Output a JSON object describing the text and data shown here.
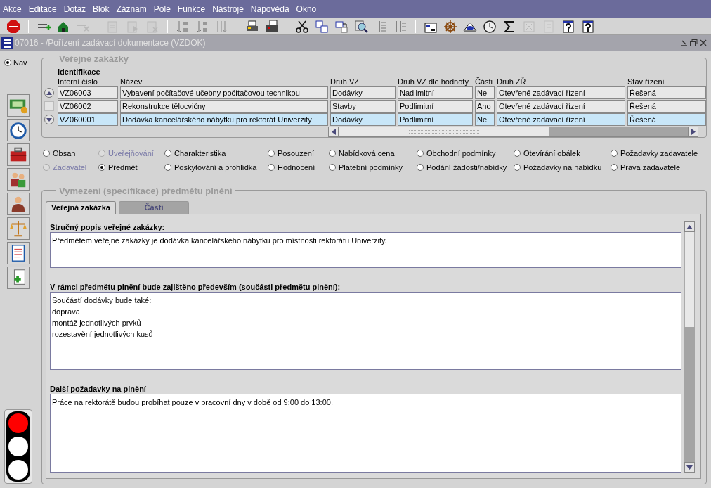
{
  "menu": [
    "Akce",
    "Editace",
    "Dotaz",
    "Blok",
    "Záznam",
    "Pole",
    "Funkce",
    "Nástroje",
    "Nápověda",
    "Okno"
  ],
  "toolbar": [
    {
      "kind": "exit",
      "disabled": false
    },
    {
      "kind": "sep"
    },
    {
      "kind": "add",
      "disabled": false
    },
    {
      "kind": "save",
      "disabled": false
    },
    {
      "kind": "clear",
      "disabled": true
    },
    {
      "kind": "sep"
    },
    {
      "kind": "query",
      "disabled": true
    },
    {
      "kind": "run",
      "disabled": true
    },
    {
      "kind": "cancel",
      "disabled": true
    },
    {
      "kind": "sep"
    },
    {
      "kind": "sortaz",
      "disabled": false
    },
    {
      "kind": "sortza",
      "disabled": false
    },
    {
      "kind": "sortmulti",
      "disabled": false
    },
    {
      "kind": "sep"
    },
    {
      "kind": "print",
      "disabled": false
    },
    {
      "kind": "printer",
      "disabled": false
    },
    {
      "kind": "sep"
    },
    {
      "kind": "cut",
      "disabled": false
    },
    {
      "kind": "copy",
      "disabled": false
    },
    {
      "kind": "paste",
      "disabled": false
    },
    {
      "kind": "zoom",
      "disabled": false
    },
    {
      "kind": "list",
      "disabled": false
    },
    {
      "kind": "list2",
      "disabled": false
    },
    {
      "kind": "sep"
    },
    {
      "kind": "form",
      "disabled": false
    },
    {
      "kind": "wheel",
      "disabled": false
    },
    {
      "kind": "eye",
      "disabled": false
    },
    {
      "kind": "clock",
      "disabled": false
    },
    {
      "kind": "sigma",
      "disabled": false
    },
    {
      "kind": "grid",
      "disabled": true
    },
    {
      "kind": "doc",
      "disabled": true
    },
    {
      "kind": "help",
      "disabled": false
    },
    {
      "kind": "help",
      "disabled": false
    }
  ],
  "window": {
    "title": "07016 - /Pořízení zadávací dokumentace (VZDOK)"
  },
  "nav": {
    "label": "Nav",
    "selected": true
  },
  "traffic_light": [
    {
      "on": true
    },
    {
      "on": false
    },
    {
      "on": false
    }
  ],
  "contracts": {
    "title": "Veřejné zakázky",
    "group_label": "Identifikace",
    "columns": [
      "Interní číslo",
      "Název",
      "Druh VZ",
      "Druh VZ dle hodnoty",
      "Části",
      "Druh ZŘ",
      "Stav řízení"
    ],
    "rows": [
      {
        "selected": false,
        "cells": [
          "VZ06003",
          "Vybavení počítačové učebny počítačovou technikou",
          "Dodávky",
          "Nadlimitní",
          "Ne",
          "Otevřené zadávací řízení",
          "Řešená"
        ]
      },
      {
        "selected": false,
        "cells": [
          "VZ06002",
          "Rekonstrukce tělocvičny",
          "Stavby",
          "Podlimitní",
          "Ano",
          "Otevřené zadávací řízení",
          "Řešená"
        ]
      },
      {
        "selected": true,
        "cells": [
          "VZ060001",
          "Dodávka kancelářského nábytku pro rektorát Univerzity",
          "Dodávky",
          "Podlimitní",
          "Ne",
          "Otevřené zadávací řízení",
          "Řešená"
        ]
      }
    ]
  },
  "sections": [
    {
      "label": "Obsah",
      "selected": false,
      "disabled": false
    },
    {
      "label": "Uveřejňování",
      "selected": false,
      "disabled": true
    },
    {
      "label": "Charakteristika",
      "selected": false,
      "disabled": false
    },
    {
      "label": "Posouzení",
      "selected": false,
      "disabled": false
    },
    {
      "label": "Nabídková cena",
      "selected": false,
      "disabled": false
    },
    {
      "label": "Obchodní podmínky",
      "selected": false,
      "disabled": false
    },
    {
      "label": "Otevírání obálek",
      "selected": false,
      "disabled": false
    },
    {
      "label": "Požadavky zadavatele",
      "selected": false,
      "disabled": false
    },
    {
      "label": "Zadavatel",
      "selected": false,
      "disabled": true
    },
    {
      "label": "Předmět",
      "selected": true,
      "disabled": false
    },
    {
      "label": "Poskytování a prohlídka",
      "selected": false,
      "disabled": false
    },
    {
      "label": "Hodnocení",
      "selected": false,
      "disabled": false
    },
    {
      "label": "Platební podmínky",
      "selected": false,
      "disabled": false
    },
    {
      "label": "Podání žádosti/nabídky",
      "selected": false,
      "disabled": false
    },
    {
      "label": "Požadavky na nabídku",
      "selected": false,
      "disabled": false
    },
    {
      "label": "Práva zadavatele",
      "selected": false,
      "disabled": false
    }
  ],
  "subject": {
    "title": "Vymezení (specifikace) předmětu plnění",
    "tabs": [
      {
        "label": "Veřejná zakázka",
        "selected": true
      },
      {
        "label": "Části",
        "selected": false
      }
    ],
    "fields": [
      {
        "label": "Stručný popis veřejné zakázky:",
        "value": "Předmětem veřejné zakázky je dodávka kancelářského nábytku pro místnosti rektorátu Univerzity."
      },
      {
        "label": "V rámci předmětu plnění bude zajištěno především (součásti předmětu plnění):",
        "value": "Součástí dodávky bude také:\ndoprava\nmontáž jednotlivých prvků\nrozestavění jednotlivých kusů"
      },
      {
        "label": "Další požadavky na plnění",
        "value": "Práce na rektorátě budou probíhat pouze v pracovní dny v době od 9:00 do 13:00."
      }
    ]
  }
}
